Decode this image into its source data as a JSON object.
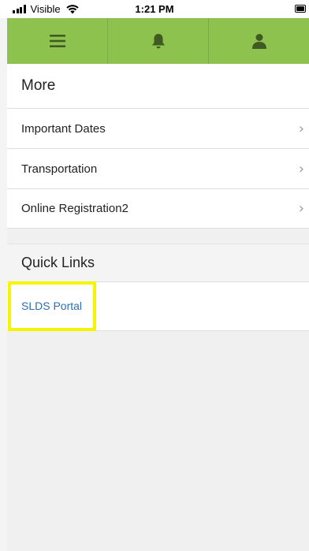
{
  "status_bar": {
    "carrier": "Visible",
    "time": "1:21 PM"
  },
  "navbar": {
    "icons": [
      "menu-icon",
      "bell-icon",
      "user-icon"
    ],
    "color": "#8dc24f",
    "icon_color": "#3f5a23"
  },
  "more": {
    "title": "More",
    "items": [
      {
        "label": "Important Dates"
      },
      {
        "label": "Transportation"
      },
      {
        "label": "Online Registration2"
      }
    ]
  },
  "quick_links": {
    "title": "Quick Links",
    "links": [
      {
        "label": "SLDS Portal"
      }
    ],
    "highlight_color": "#f5f500"
  }
}
